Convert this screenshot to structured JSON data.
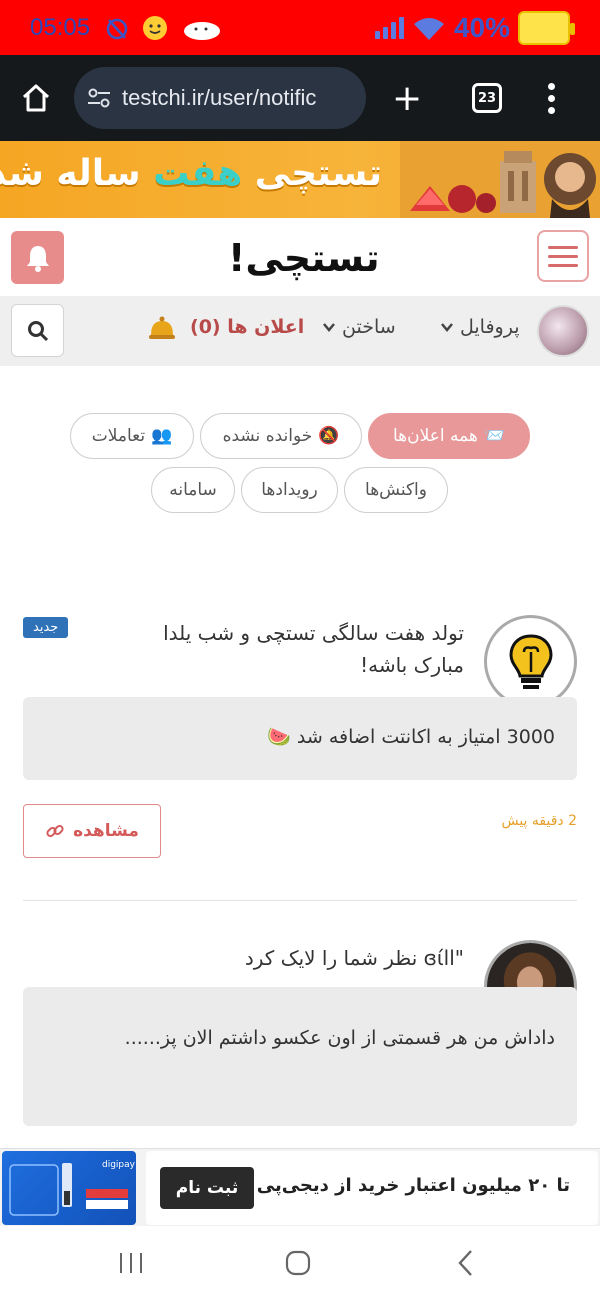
{
  "status_bar": {
    "time": "05:05",
    "battery": "40%",
    "colors": {
      "background": "#ff0000",
      "text": "#2b47b8"
    }
  },
  "browser": {
    "url": "testchi.ir/user/notific",
    "tab_count": "23"
  },
  "banner": {
    "text_part1": "تستچی",
    "text_highlight": "هفت",
    "text_part2": "ساله شد"
  },
  "site": {
    "logo": "تستچی!"
  },
  "nav": {
    "profile": "پروفایل",
    "build": "ساختن",
    "notifications": "اعلان ها (0)"
  },
  "filters": [
    {
      "label": "همه اعلان‌ها",
      "icon": "envelope-icon",
      "active": true
    },
    {
      "label": "خوانده نشده",
      "icon": "bell-off-icon",
      "active": false
    },
    {
      "label": "تعاملات",
      "icon": "users-icon",
      "active": false
    },
    {
      "label": "واکنش‌ها",
      "icon": "",
      "active": false
    },
    {
      "label": "رویدادها",
      "icon": "",
      "active": false
    },
    {
      "label": "سامانه",
      "icon": "",
      "active": false
    }
  ],
  "notifications": [
    {
      "title": "تولد هفت سالگی تستچی و شب یلدا مبارک باشه!",
      "badge": "جدید",
      "body": "3000 امتیاز به اکانتت اضافه شد 🍉",
      "time": "2 دقیقه پیش",
      "action": "مشاهده"
    },
    {
      "title": "\"ɞίll نظر شما را لایک کرد",
      "body": "داداش من هر قسمتی از اون عکسو داشتم الان پز......"
    }
  ],
  "ad": {
    "text": "تا ۲۰ میلیون اعتبار خرید از دیجی‌پی",
    "button": "ثبت نام",
    "brand": "digipay"
  }
}
